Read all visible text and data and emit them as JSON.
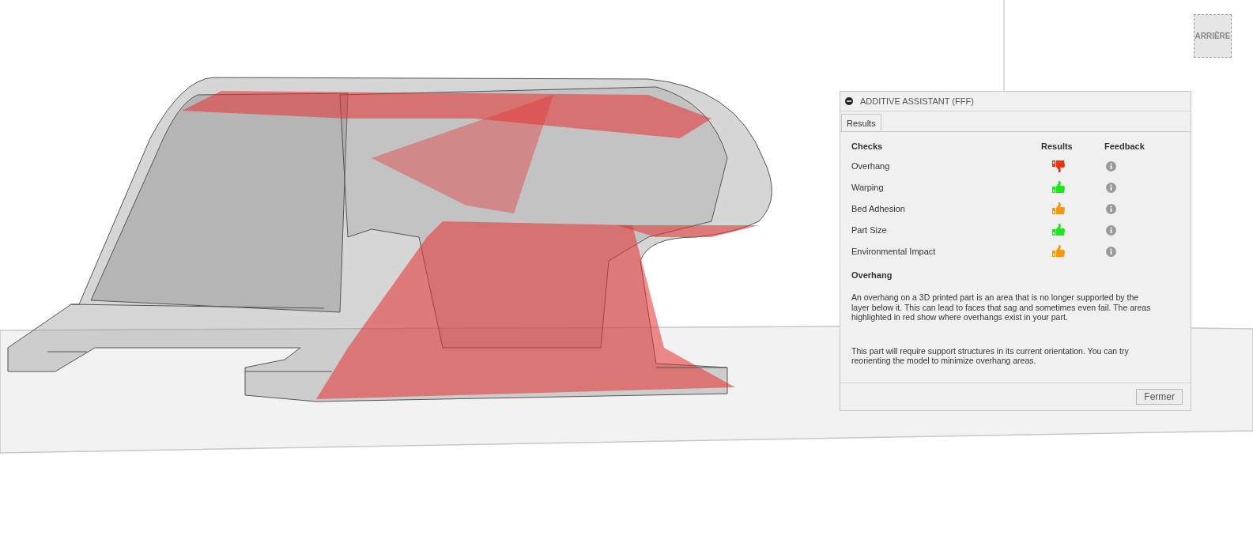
{
  "view_cube": {
    "face_label": "ARRIÈRE"
  },
  "panel": {
    "title": "ADDITIVE ASSISTANT (FFF)",
    "tabs": [
      {
        "label": "Results",
        "selected": true
      }
    ],
    "columns": [
      "Checks",
      "Results",
      "Feedback"
    ],
    "checks": [
      {
        "name": "Overhang",
        "kind": "thumbs_down",
        "color": "#e8360e"
      },
      {
        "name": "Warping",
        "kind": "thumbs_up",
        "color": "#1ee61e"
      },
      {
        "name": "Bed Adhesion",
        "kind": "thumbs_up",
        "color": "#f39a12"
      },
      {
        "name": "Part Size",
        "kind": "thumbs_up",
        "color": "#1ee61e"
      },
      {
        "name": "Environmental Impact",
        "kind": "thumbs_up",
        "color": "#f39a12"
      }
    ],
    "detail_title": "Overhang",
    "paragraphs": [
      "An overhang on a 3D printed part is an area that is no longer supported by the layer below it. This can lead to faces that sag and sometimes even fail. The areas highlighted in red show where overhangs exist in your part.",
      "This part will require support structures in its current orientation. You can try reorienting the model to minimize overhang areas."
    ],
    "close_button": "Fermer"
  }
}
